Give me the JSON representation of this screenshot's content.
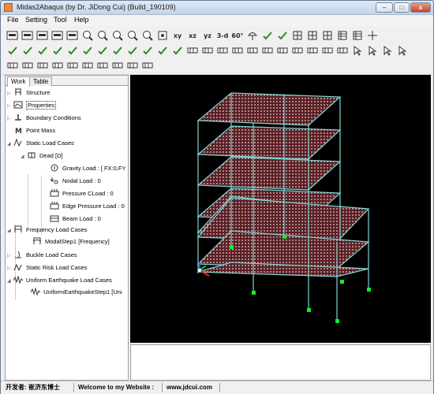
{
  "window": {
    "title": "Midas2Abaqus (by Dr. JiDong Cui) (Build_190109)",
    "min_label": "–",
    "max_label": "□",
    "close_label": "x"
  },
  "menu": [
    {
      "label": "File"
    },
    {
      "label": "Setting"
    },
    {
      "label": "Tool"
    },
    {
      "label": "Help"
    }
  ],
  "toolbar": {
    "view_labels": [
      "xy",
      "xz",
      "yz",
      "3-d",
      "60°"
    ]
  },
  "panel": {
    "tabs": [
      {
        "label": "Work",
        "active": true
      },
      {
        "label": "Table",
        "active": false
      }
    ],
    "tree": [
      {
        "label": "Structure"
      },
      {
        "label": "Properties",
        "selected": true
      },
      {
        "label": "Boundary Conditions"
      },
      {
        "label": "Point Mass"
      },
      {
        "label": "Static Load Cases"
      },
      {
        "label": "Dead [D]"
      },
      {
        "label": "Gravity Load : [ FX:0,FY"
      },
      {
        "label": "Nodal Load : 0"
      },
      {
        "label": "Pressure CLoad : 0"
      },
      {
        "label": "Edge Pressure Load : 0"
      },
      {
        "label": "Beam Load : 0"
      },
      {
        "label": "Frequency Load Cases"
      },
      {
        "label": "ModalStep1 [Frequency]"
      },
      {
        "label": "Buckle Load Cases"
      },
      {
        "label": "Static Risk Load Cases"
      },
      {
        "label": "Uniform Earthquake Load Cases"
      },
      {
        "label": "UniformEarthquakeStep1 [Uni"
      }
    ]
  },
  "colors": {
    "frame": "#7fd6d6",
    "slab": "#5a1f24",
    "slab_dot": "#e9d0d0",
    "support": "#11ee22",
    "viewport_bg": "#000000"
  },
  "status": {
    "publisher_label": "开发者: 崔济东博士",
    "welcome": "Welcome to my Website :",
    "website": "www.jdcui.com"
  }
}
